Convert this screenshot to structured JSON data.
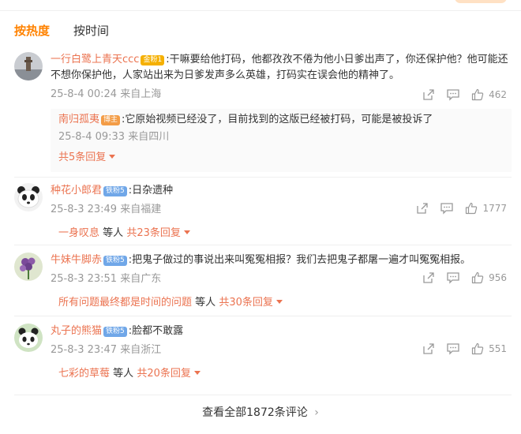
{
  "tabs": [
    {
      "label": "按热度",
      "active": true
    },
    {
      "label": "按时间",
      "active": false
    }
  ],
  "comments": [
    {
      "user": "一行白鹭上青天ccc",
      "badge": "金粉1",
      "badge_type": "gold",
      "text": ":干嘛要给他打码，他都孜孜不倦为他小日爹出声了，你还保护他？他可能还不想你保护他，人家站出来为日爹发声多么英雄，打码实在误会他的精神了。",
      "time": "25-8-4 00:24 来自上海",
      "likes": "462",
      "avatar": "tower-avatar",
      "reply": {
        "user": "南归孤夷",
        "badge": "博主",
        "text": ":它原始视频已经没了，目前找到的这版已经被打码，可能是被投诉了",
        "time": "25-8-4 09:33 来自四川",
        "more": "共5条回复"
      }
    },
    {
      "user": "种花小郎君",
      "badge": "铁粉5",
      "badge_type": "blue",
      "text": ":日杂遗种",
      "time": "25-8-3 23:49 来自福建",
      "likes": "1777",
      "avatar": "panda-avatar",
      "reply_users": "一身叹息",
      "reply_mid": "等人",
      "reply_more": "共23条回复"
    },
    {
      "user": "牛妹牛脚赤",
      "badge": "铁粉5",
      "badge_type": "blue",
      "text": ":把鬼子做过的事说出来叫冤冤相报？我们去把鬼子都屠一遍才叫冤冤相报。",
      "time": "25-8-3 23:51 来自广东",
      "likes": "956",
      "avatar": "flower-avatar",
      "reply_users": "所有问题最终都是时间的问题",
      "reply_mid": "等人",
      "reply_more": "共30条回复"
    },
    {
      "user": "丸子的熊猫",
      "badge": "铁粉5",
      "badge_type": "blue",
      "text": ":脸都不敢露",
      "time": "25-8-3 23:47 来自浙江",
      "likes": "551",
      "avatar": "panda2-avatar",
      "reply_users": "七彩的草莓",
      "reply_mid": "等人",
      "reply_more": "共20条回复"
    }
  ],
  "view_all": "查看全部1872条评论",
  "colors": {
    "accent": "#ff8200",
    "username": "#eb7350",
    "meta": "#999999"
  }
}
